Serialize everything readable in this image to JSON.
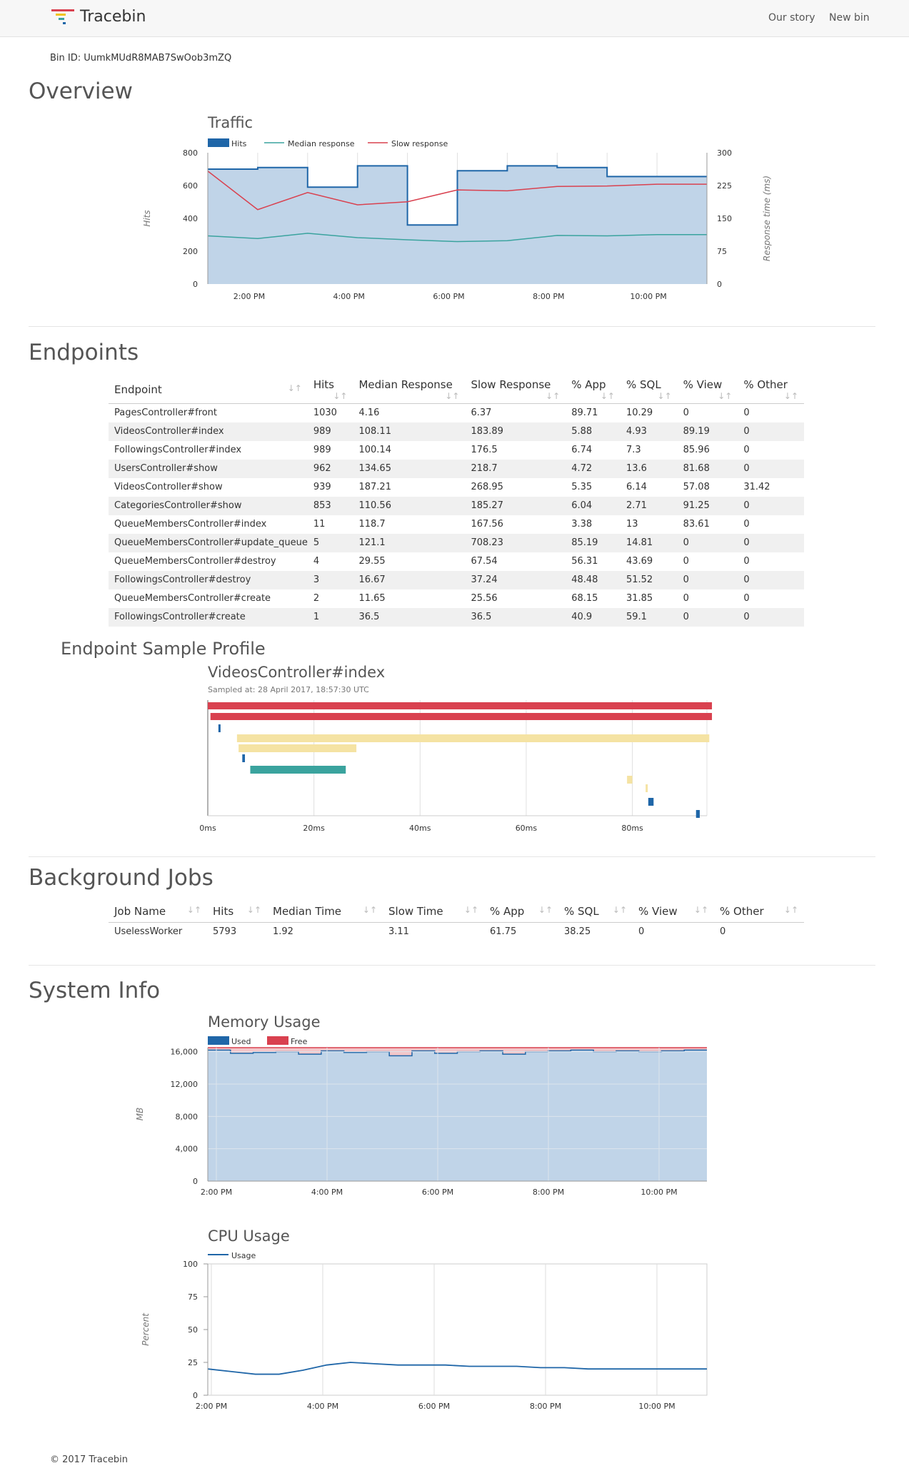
{
  "nav": {
    "brand": "Tracebin",
    "links": [
      "Our story",
      "New bin"
    ]
  },
  "bin_id": "Bin ID: UumkMUdR8MAB7SwOob3mZQ",
  "sections": {
    "overview": "Overview",
    "endpoints": "Endpoints",
    "endpoint_sample": "Endpoint Sample Profile",
    "background_jobs": "Background Jobs",
    "system_info": "System Info"
  },
  "chart_data": [
    {
      "type": "area",
      "title": "Traffic",
      "legend": [
        "Hits",
        "Median response",
        "Slow response"
      ],
      "ylabel": "Hits",
      "y2label": "Response time (ms)",
      "ylim": [
        0,
        800
      ],
      "y2lim": [
        0,
        300
      ],
      "yticks": [
        "0",
        "200",
        "400",
        "600",
        "800"
      ],
      "y2ticks": [
        "0",
        "75",
        "150",
        "225",
        "300"
      ],
      "xticks": [
        "2:00 PM",
        "4:00 PM",
        "6:00 PM",
        "8:00 PM",
        "10:00 PM"
      ],
      "x": [
        1,
        2,
        3,
        4,
        5,
        6,
        7,
        8,
        9,
        10
      ],
      "series": [
        {
          "name": "Hits",
          "values": [
            700,
            710,
            590,
            720,
            360,
            690,
            720,
            710,
            655,
            655
          ]
        },
        {
          "name": "Median response",
          "values": [
            110,
            104,
            116,
            106,
            101,
            97,
            99,
            111,
            110,
            113
          ]
        },
        {
          "name": "Slow response",
          "values": [
            258,
            170,
            209,
            181,
            188,
            215,
            213,
            223,
            224,
            228
          ]
        }
      ]
    },
    {
      "type": "area",
      "title": "Memory Usage",
      "legend": [
        "Used",
        "Free"
      ],
      "ylabel": "MB",
      "ylim": [
        0,
        16500
      ],
      "yticks": [
        "0",
        "4,000",
        "8,000",
        "12,000",
        "16,000"
      ],
      "xticks": [
        "2:00 PM",
        "4:00 PM",
        "6:00 PM",
        "8:00 PM",
        "10:00 PM"
      ],
      "series": [
        {
          "name": "Used",
          "values": [
            16200,
            15800,
            15900,
            16000,
            15700,
            16100,
            15900,
            16000,
            15500,
            16100,
            15800,
            16000,
            16100,
            15700,
            16000,
            16100,
            16200,
            16000,
            16100,
            16000,
            16100,
            16200
          ]
        },
        {
          "name": "Free",
          "values": [
            300,
            700,
            600,
            500,
            800,
            400,
            600,
            500,
            1000,
            400,
            700,
            500,
            400,
            800,
            500,
            400,
            300,
            500,
            400,
            500,
            400,
            300
          ]
        }
      ]
    },
    {
      "type": "line",
      "title": "CPU Usage",
      "legend": [
        "Usage"
      ],
      "ylabel": "Percent",
      "ylim": [
        0,
        100
      ],
      "yticks": [
        "0",
        "25",
        "50",
        "75",
        "100"
      ],
      "xticks": [
        "2:00 PM",
        "4:00 PM",
        "6:00 PM",
        "8:00 PM",
        "10:00 PM"
      ],
      "series": [
        {
          "name": "Usage",
          "values": [
            20,
            18,
            16,
            16,
            19,
            23,
            25,
            24,
            23,
            23,
            23,
            22,
            22,
            22,
            21,
            21,
            20,
            20,
            20,
            20,
            20,
            20
          ]
        }
      ]
    }
  ],
  "endpoints_table": {
    "headers": [
      "Endpoint",
      "Hits",
      "Median Response",
      "Slow Response",
      "% App",
      "% SQL",
      "% View",
      "% Other"
    ],
    "rows": [
      [
        "PagesController#front",
        "1030",
        "4.16",
        "6.37",
        "89.71",
        "10.29",
        "0",
        "0"
      ],
      [
        "VideosController#index",
        "989",
        "108.11",
        "183.89",
        "5.88",
        "4.93",
        "89.19",
        "0"
      ],
      [
        "FollowingsController#index",
        "989",
        "100.14",
        "176.5",
        "6.74",
        "7.3",
        "85.96",
        "0"
      ],
      [
        "UsersController#show",
        "962",
        "134.65",
        "218.7",
        "4.72",
        "13.6",
        "81.68",
        "0"
      ],
      [
        "VideosController#show",
        "939",
        "187.21",
        "268.95",
        "5.35",
        "6.14",
        "57.08",
        "31.42"
      ],
      [
        "CategoriesController#show",
        "853",
        "110.56",
        "185.27",
        "6.04",
        "2.71",
        "91.25",
        "0"
      ],
      [
        "QueueMembersController#index",
        "11",
        "118.7",
        "167.56",
        "3.38",
        "13",
        "83.61",
        "0"
      ],
      [
        "QueueMembersController#update_queue",
        "5",
        "121.1",
        "708.23",
        "85.19",
        "14.81",
        "0",
        "0"
      ],
      [
        "QueueMembersController#destroy",
        "4",
        "29.55",
        "67.54",
        "56.31",
        "43.69",
        "0",
        "0"
      ],
      [
        "FollowingsController#destroy",
        "3",
        "16.67",
        "37.24",
        "48.48",
        "51.52",
        "0",
        "0"
      ],
      [
        "QueueMembersController#create",
        "2",
        "11.65",
        "25.56",
        "68.15",
        "31.85",
        "0",
        "0"
      ],
      [
        "FollowingsController#create",
        "1",
        "36.5",
        "36.5",
        "40.9",
        "59.1",
        "0",
        "0"
      ]
    ]
  },
  "profile": {
    "title": "VideosController#index",
    "sampled_at": "Sampled at: 28 April 2017, 18:57:30 UTC",
    "xticks": [
      "0ms",
      "20ms",
      "40ms",
      "60ms",
      "80ms"
    ],
    "bars": [
      {
        "start": 0,
        "end": 95,
        "row": 0,
        "color": "#d9414f"
      },
      {
        "start": 0.5,
        "end": 95,
        "row": 1,
        "color": "#d9414f"
      },
      {
        "start": 2,
        "end": 2.4,
        "row": 2,
        "color": "#1f66a8"
      },
      {
        "start": 5.5,
        "end": 94.5,
        "row": 3,
        "color": "#f5e3a3"
      },
      {
        "start": 5.8,
        "end": 28,
        "row": 4,
        "color": "#f5e3a3"
      },
      {
        "start": 6.5,
        "end": 7,
        "row": 5,
        "color": "#1f66a8"
      },
      {
        "start": 8,
        "end": 26,
        "row": 6,
        "color": "#3aa39e"
      },
      {
        "start": 79,
        "end": 80,
        "row": 7,
        "color": "#f5e3a3"
      },
      {
        "start": 82.5,
        "end": 82.8,
        "row": 8,
        "color": "#f5e3a3"
      },
      {
        "start": 83,
        "end": 84,
        "row": 9,
        "color": "#1f66a8"
      },
      {
        "start": 92,
        "end": 92.7,
        "row": 10,
        "color": "#1f66a8"
      }
    ]
  },
  "jobs_table": {
    "headers": [
      "Job Name",
      "Hits",
      "Median Time",
      "Slow Time",
      "% App",
      "% SQL",
      "% View",
      "% Other"
    ],
    "rows": [
      [
        "UselessWorker",
        "5793",
        "1.92",
        "3.11",
        "61.75",
        "38.25",
        "0",
        "0"
      ]
    ]
  },
  "footer": "© 2017 Tracebin",
  "colors": {
    "hits": "#1f66a8",
    "hits_fill": "#c0d4e8",
    "median": "#3aa39e",
    "slow": "#d9414f"
  }
}
